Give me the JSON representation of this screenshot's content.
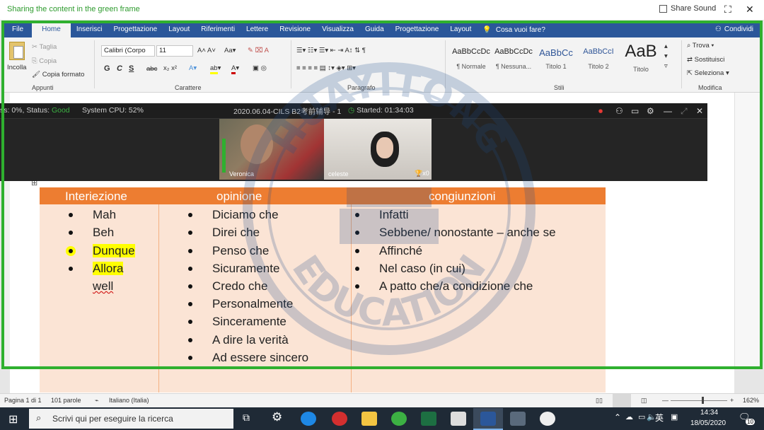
{
  "share_bar": {
    "message": "Sharing the content in the green frame",
    "share_sound_label": "Share Sound"
  },
  "ribbon_tabs": [
    "File",
    "Home",
    "Inserisci",
    "Progettazione",
    "Layout",
    "Riferimenti",
    "Lettere",
    "Revisione",
    "Visualizza",
    "Guida",
    "Progettazione",
    "Layout"
  ],
  "active_tab": "Home",
  "tell_me": "Cosa vuoi fare?",
  "share_button": "Condividi",
  "clipboard": {
    "paste": "Incolla",
    "cut": "Taglia",
    "copy": "Copia",
    "format_painter": "Copia formato",
    "label": "Appunti"
  },
  "font": {
    "name": "Calibri (Corpo",
    "size": "11",
    "label": "Carattere",
    "bold": "G",
    "italic": "C",
    "underline": "S",
    "strike": "abc"
  },
  "paragraph": {
    "label": "Paragrafo"
  },
  "styles": {
    "label": "Stili",
    "items": [
      {
        "sample": "AaBbCcDc",
        "name": "¶ Normale"
      },
      {
        "sample": "AaBbCcDc",
        "name": "¶ Nessuna..."
      },
      {
        "sample": "AaBbCc",
        "name": "Titolo 1"
      },
      {
        "sample": "AaBbCcI",
        "name": "Titolo 2"
      },
      {
        "sample": "AaB",
        "name": "Titolo"
      }
    ]
  },
  "editing": {
    "label": "Modifica",
    "find": "Trova",
    "replace": "Sostituisci",
    "select": "Seleziona"
  },
  "meeting": {
    "stats_prefix": "ss: 0%, Status:",
    "status_value": "Good",
    "cpu": "System CPU: 52%",
    "title": "2020.06.04-CILS B2考前辅导 - 1",
    "started": "Started: 01:34:03",
    "participants": [
      {
        "name": "Veronica"
      },
      {
        "name": "celeste"
      }
    ],
    "reward_count": "x0"
  },
  "table": {
    "headers": [
      "Interiezione",
      "opinione",
      "congiunzioni"
    ],
    "col1": [
      "Mah",
      "Beh",
      "Dunque",
      "Allora",
      "well"
    ],
    "col2": [
      "Diciamo che",
      "Direi che",
      "Penso che",
      "Sicuramente",
      "Credo che",
      "Personalmente",
      "Sinceramente",
      "A dire la verità",
      "Ad essere sincero"
    ],
    "col3": [
      "Infatti",
      "Sebbene/ nonostante – anche se",
      "Affinché",
      "Nel caso (in cui)",
      "A patto che/a condizione che"
    ]
  },
  "statusbar": {
    "page": "Pagina 1 di 1",
    "words": "101 parole",
    "language": "Italiano (Italia)",
    "zoom": "162%"
  },
  "taskbar": {
    "search_placeholder": "Scrivi qui per eseguire la ricerca",
    "ime": "英",
    "time": "14:34",
    "date": "18/05/2020",
    "notif_count": "10"
  },
  "watermark": {
    "top_text": "HUAYITONG",
    "bottom_text": "EDUCATION"
  },
  "colors": {
    "word_blue": "#2b579a",
    "share_green": "#2fb02f",
    "table_header": "#ed7d31",
    "table_body": "#fbe4d5",
    "highlight": "#ffff00"
  }
}
